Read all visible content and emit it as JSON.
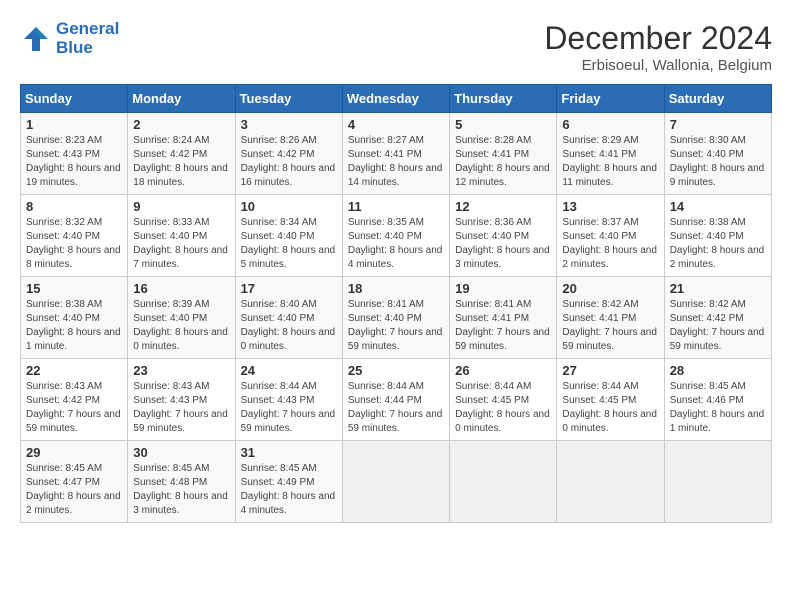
{
  "header": {
    "logo_line1": "General",
    "logo_line2": "Blue",
    "title": "December 2024",
    "subtitle": "Erbisoeul, Wallonia, Belgium"
  },
  "days_of_week": [
    "Sunday",
    "Monday",
    "Tuesday",
    "Wednesday",
    "Thursday",
    "Friday",
    "Saturday"
  ],
  "weeks": [
    [
      {
        "day": "1",
        "sunrise": "8:23 AM",
        "sunset": "4:43 PM",
        "daylight": "8 hours and 19 minutes."
      },
      {
        "day": "2",
        "sunrise": "8:24 AM",
        "sunset": "4:42 PM",
        "daylight": "8 hours and 18 minutes."
      },
      {
        "day": "3",
        "sunrise": "8:26 AM",
        "sunset": "4:42 PM",
        "daylight": "8 hours and 16 minutes."
      },
      {
        "day": "4",
        "sunrise": "8:27 AM",
        "sunset": "4:41 PM",
        "daylight": "8 hours and 14 minutes."
      },
      {
        "day": "5",
        "sunrise": "8:28 AM",
        "sunset": "4:41 PM",
        "daylight": "8 hours and 12 minutes."
      },
      {
        "day": "6",
        "sunrise": "8:29 AM",
        "sunset": "4:41 PM",
        "daylight": "8 hours and 11 minutes."
      },
      {
        "day": "7",
        "sunrise": "8:30 AM",
        "sunset": "4:40 PM",
        "daylight": "8 hours and 9 minutes."
      }
    ],
    [
      {
        "day": "8",
        "sunrise": "8:32 AM",
        "sunset": "4:40 PM",
        "daylight": "8 hours and 8 minutes."
      },
      {
        "day": "9",
        "sunrise": "8:33 AM",
        "sunset": "4:40 PM",
        "daylight": "8 hours and 7 minutes."
      },
      {
        "day": "10",
        "sunrise": "8:34 AM",
        "sunset": "4:40 PM",
        "daylight": "8 hours and 5 minutes."
      },
      {
        "day": "11",
        "sunrise": "8:35 AM",
        "sunset": "4:40 PM",
        "daylight": "8 hours and 4 minutes."
      },
      {
        "day": "12",
        "sunrise": "8:36 AM",
        "sunset": "4:40 PM",
        "daylight": "8 hours and 3 minutes."
      },
      {
        "day": "13",
        "sunrise": "8:37 AM",
        "sunset": "4:40 PM",
        "daylight": "8 hours and 2 minutes."
      },
      {
        "day": "14",
        "sunrise": "8:38 AM",
        "sunset": "4:40 PM",
        "daylight": "8 hours and 2 minutes."
      }
    ],
    [
      {
        "day": "15",
        "sunrise": "8:38 AM",
        "sunset": "4:40 PM",
        "daylight": "8 hours and 1 minute."
      },
      {
        "day": "16",
        "sunrise": "8:39 AM",
        "sunset": "4:40 PM",
        "daylight": "8 hours and 0 minutes."
      },
      {
        "day": "17",
        "sunrise": "8:40 AM",
        "sunset": "4:40 PM",
        "daylight": "8 hours and 0 minutes."
      },
      {
        "day": "18",
        "sunrise": "8:41 AM",
        "sunset": "4:40 PM",
        "daylight": "7 hours and 59 minutes."
      },
      {
        "day": "19",
        "sunrise": "8:41 AM",
        "sunset": "4:41 PM",
        "daylight": "7 hours and 59 minutes."
      },
      {
        "day": "20",
        "sunrise": "8:42 AM",
        "sunset": "4:41 PM",
        "daylight": "7 hours and 59 minutes."
      },
      {
        "day": "21",
        "sunrise": "8:42 AM",
        "sunset": "4:42 PM",
        "daylight": "7 hours and 59 minutes."
      }
    ],
    [
      {
        "day": "22",
        "sunrise": "8:43 AM",
        "sunset": "4:42 PM",
        "daylight": "7 hours and 59 minutes."
      },
      {
        "day": "23",
        "sunrise": "8:43 AM",
        "sunset": "4:43 PM",
        "daylight": "7 hours and 59 minutes."
      },
      {
        "day": "24",
        "sunrise": "8:44 AM",
        "sunset": "4:43 PM",
        "daylight": "7 hours and 59 minutes."
      },
      {
        "day": "25",
        "sunrise": "8:44 AM",
        "sunset": "4:44 PM",
        "daylight": "7 hours and 59 minutes."
      },
      {
        "day": "26",
        "sunrise": "8:44 AM",
        "sunset": "4:45 PM",
        "daylight": "8 hours and 0 minutes."
      },
      {
        "day": "27",
        "sunrise": "8:44 AM",
        "sunset": "4:45 PM",
        "daylight": "8 hours and 0 minutes."
      },
      {
        "day": "28",
        "sunrise": "8:45 AM",
        "sunset": "4:46 PM",
        "daylight": "8 hours and 1 minute."
      }
    ],
    [
      {
        "day": "29",
        "sunrise": "8:45 AM",
        "sunset": "4:47 PM",
        "daylight": "8 hours and 2 minutes."
      },
      {
        "day": "30",
        "sunrise": "8:45 AM",
        "sunset": "4:48 PM",
        "daylight": "8 hours and 3 minutes."
      },
      {
        "day": "31",
        "sunrise": "8:45 AM",
        "sunset": "4:49 PM",
        "daylight": "8 hours and 4 minutes."
      },
      null,
      null,
      null,
      null
    ]
  ],
  "labels": {
    "sunrise": "Sunrise: ",
    "sunset": "Sunset: ",
    "daylight": "Daylight: "
  }
}
